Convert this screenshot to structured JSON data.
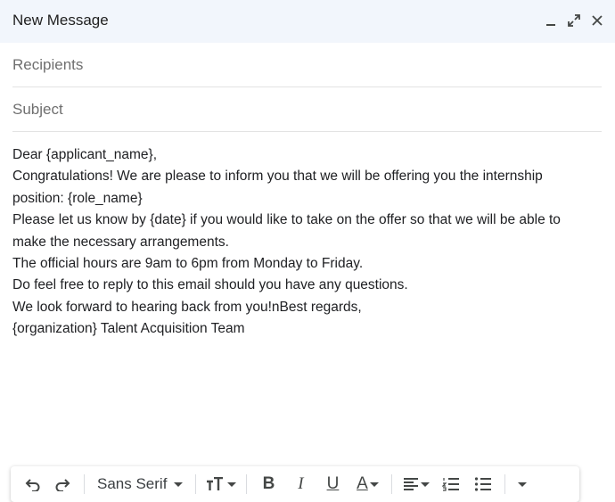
{
  "window": {
    "title": "New Message"
  },
  "recipients": {
    "placeholder": "Recipients",
    "value": ""
  },
  "subject": {
    "placeholder": "Subject",
    "value": ""
  },
  "message_lines": [
    "Dear {applicant_name},",
    "Congratulations! We are please to inform you that we will be offering you the internship",
    "position: {role_name}",
    "Please let us know by {date} if you would like to take on the offer so that we will be able to",
    "make the necessary arrangements.",
    "The official hours are 9am to 6pm from Monday to Friday.",
    "Do feel free to reply to this email should you have any questions.",
    "We look forward to hearing back from you!nBest regards,",
    "{organization} Talent Acquisition Team"
  ],
  "toolbar": {
    "font": "Sans Serif",
    "icons": [
      "undo-icon",
      "redo-icon",
      "font-size-icon",
      "bold-icon",
      "italic-icon",
      "underline-icon",
      "text-color-icon",
      "align-icon",
      "numbered-list-icon",
      "bulleted-list-icon",
      "more-formatting-icon"
    ]
  }
}
